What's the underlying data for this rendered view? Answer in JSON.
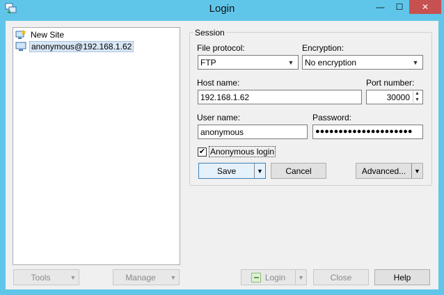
{
  "window": {
    "title": "Login",
    "minimize_glyph": "—",
    "maximize_glyph": "☐",
    "close_glyph": "✕"
  },
  "site_tree": {
    "items": [
      {
        "label": "New Site",
        "icon": "new-site-icon"
      },
      {
        "label": "anonymous@192.168.1.62",
        "icon": "computer-icon",
        "selected": true
      }
    ]
  },
  "session": {
    "group_title": "Session",
    "file_protocol_label": "File protocol:",
    "file_protocol_value": "FTP",
    "encryption_label": "Encryption:",
    "encryption_value": "No encryption",
    "host_name_label": "Host name:",
    "host_name_value": "192.168.1.62",
    "port_number_label": "Port number:",
    "port_number_value": "30000",
    "user_name_label": "User name:",
    "user_name_value": "anonymous",
    "password_label": "Password:",
    "password_value": "●●●●●●●●●●●●●●●●●●●●●",
    "anonymous_login_label": "Anonymous login",
    "anonymous_login_checked": true,
    "save_label": "Save",
    "cancel_label": "Cancel",
    "advanced_label": "Advanced..."
  },
  "bottom": {
    "tools_label": "Tools",
    "manage_label": "Manage",
    "login_label": "Login",
    "close_label": "Close",
    "help_label": "Help"
  },
  "colors": {
    "titlebar": "#5fc6ea",
    "close_button": "#c75050",
    "default_button_border": "#3c7fb1"
  }
}
